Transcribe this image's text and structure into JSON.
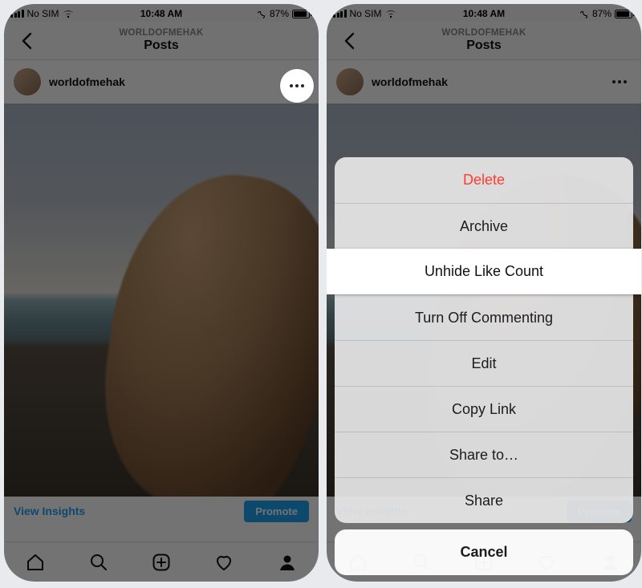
{
  "statusbar": {
    "carrier": "No SIM",
    "time": "10:48 AM",
    "battery_pct": "87%",
    "battery_fill_pct": 87
  },
  "nav": {
    "supertitle": "WORLDOFMEHAK",
    "title": "Posts"
  },
  "post": {
    "username": "worldofmehak"
  },
  "insights": {
    "view_label": "View Insights",
    "promote_label": "Promote"
  },
  "actionsheet": {
    "items": [
      {
        "label": "Delete",
        "destructive": true
      },
      {
        "label": "Archive",
        "destructive": false
      },
      {
        "label": "Unhide Like Count",
        "destructive": false
      },
      {
        "label": "Turn Off Commenting",
        "destructive": false
      },
      {
        "label": "Edit",
        "destructive": false
      },
      {
        "label": "Copy Link",
        "destructive": false
      },
      {
        "label": "Share to…",
        "destructive": false
      },
      {
        "label": "Share",
        "destructive": false
      }
    ],
    "cancel_label": "Cancel",
    "highlighted_index": 2
  }
}
